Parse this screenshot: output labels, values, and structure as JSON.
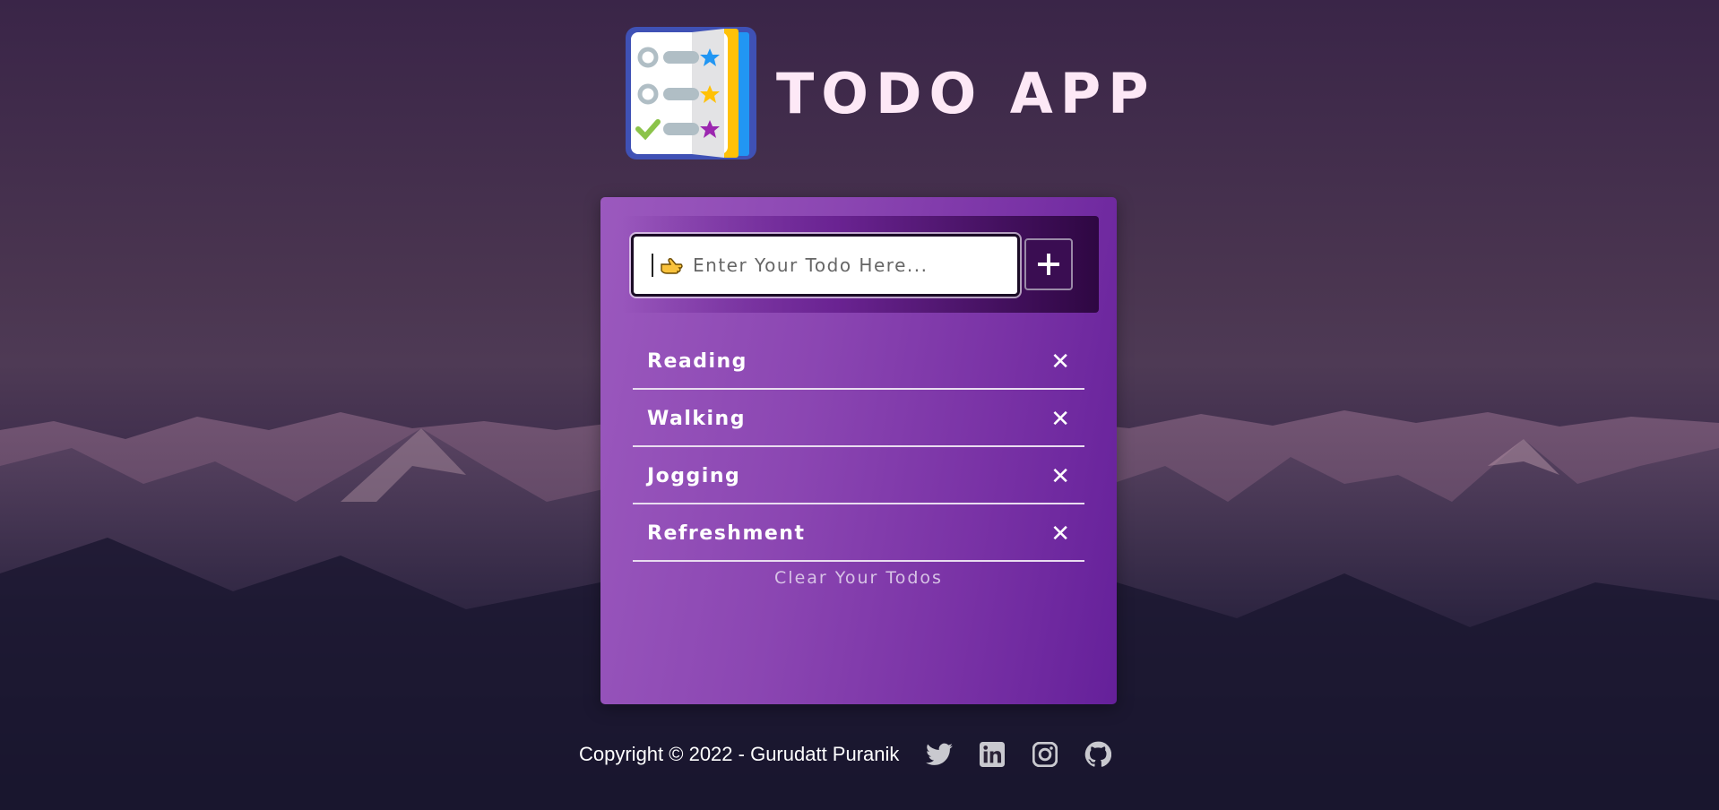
{
  "app": {
    "title": "TODO APP",
    "logo_icon": "todo-list-logo-icon"
  },
  "input": {
    "placeholder": "Enter Your Todo Here...",
    "value": "",
    "prefix_icon": "pointing-hand-icon"
  },
  "add_button": {
    "icon": "plus-icon"
  },
  "todos": [
    {
      "text": "Reading",
      "delete_icon": "close-icon"
    },
    {
      "text": "Walking",
      "delete_icon": "close-icon"
    },
    {
      "text": "Jogging",
      "delete_icon": "close-icon"
    },
    {
      "text": "Refreshment",
      "delete_icon": "close-icon"
    }
  ],
  "clear_label": "Clear Your Todos",
  "footer": {
    "copyright": "Copyright © 2022 - Gurudatt Puranik",
    "social": [
      "twitter-icon",
      "linkedin-icon",
      "instagram-icon",
      "github-icon"
    ]
  },
  "colors": {
    "title": "#fde8f6",
    "card_start": "#9b59be",
    "card_end": "#65209a",
    "text": "#ffffff",
    "icon_gray": "#c9c9cf"
  }
}
